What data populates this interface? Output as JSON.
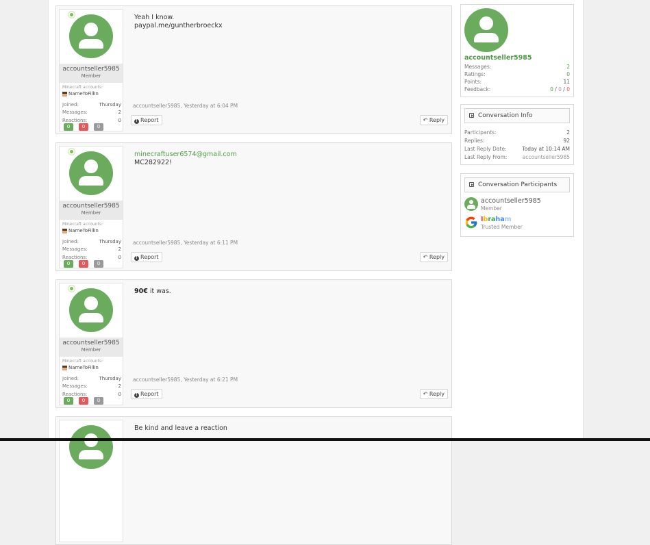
{
  "messages": [
    {
      "author": "accountseller5985",
      "rank": "Member",
      "mc_label": "Minecraft accounts:",
      "mc_name": "NameToFillIn",
      "stats": [
        {
          "k": "Joined:",
          "v": "Thursday"
        },
        {
          "k": "Messages:",
          "v": "2"
        },
        {
          "k": "Reactions:",
          "v": "0"
        }
      ],
      "badges": [
        "0",
        "0",
        "0"
      ],
      "lines": [
        "Yeah I know.",
        "paypal.me/guntherbroeckx"
      ],
      "meta": "accountseller5985, Yesterday at 6:04 PM",
      "report": "Report",
      "reply": "Reply"
    },
    {
      "author": "accountseller5985",
      "rank": "Member",
      "mc_label": "Minecraft accounts:",
      "mc_name": "NameToFillIn",
      "stats": [
        {
          "k": "Joined:",
          "v": "Thursday"
        },
        {
          "k": "Messages:",
          "v": "2"
        },
        {
          "k": "Reactions:",
          "v": "0"
        }
      ],
      "badges": [
        "0",
        "0",
        "0"
      ],
      "link": "minecraftuser6574@gmail.com",
      "line2": "MC282922!",
      "meta": "accountseller5985, Yesterday at 6:11 PM",
      "report": "Report",
      "reply": "Reply"
    },
    {
      "author": "accountseller5985",
      "rank": "Member",
      "mc_label": "Minecraft accounts:",
      "mc_name": "NameToFillIn",
      "stats": [
        {
          "k": "Joined:",
          "v": "Thursday"
        },
        {
          "k": "Messages:",
          "v": "2"
        },
        {
          "k": "Reactions:",
          "v": "0"
        }
      ],
      "badges": [
        "0",
        "0",
        "0"
      ],
      "bold": "90€",
      "rest": " it was.",
      "meta": "accountseller5985, Yesterday at 6:21 PM",
      "report": "Report",
      "reply": "Reply"
    },
    {
      "line": "Be kind and leave a reaction"
    }
  ],
  "profile": {
    "name": "accountseller5985",
    "rows": [
      {
        "k": "Messages:",
        "v": "2"
      },
      {
        "k": "Ratings:",
        "v": "0"
      },
      {
        "k": "Points:",
        "v": "11"
      },
      {
        "k": "Feedback:",
        "pos": "0",
        "neu": "0",
        "neg": "0",
        "sep": " / "
      }
    ]
  },
  "conversation_info": {
    "title": "Conversation Info",
    "rows": [
      {
        "k": "Participants:",
        "v": "2"
      },
      {
        "k": "Replies:",
        "v": "92"
      },
      {
        "k": "Last Reply Date:",
        "v": "Today at 10:14 AM"
      },
      {
        "k": "Last Reply From:",
        "v": "accountseller5985"
      }
    ]
  },
  "participants": {
    "title": "Conversation Participants",
    "list": [
      {
        "name": "accountseller5985",
        "role": "Member"
      },
      {
        "name_parts": [
          "I",
          "b",
          "ra",
          "ha",
          "m",
          ""
        ],
        "role": "Trusted Member"
      }
    ]
  },
  "colors": {
    "accent": "#6aab5e",
    "link": "#4f9a44",
    "danger": "#e35959",
    "neutral": "#9a9a9a"
  }
}
